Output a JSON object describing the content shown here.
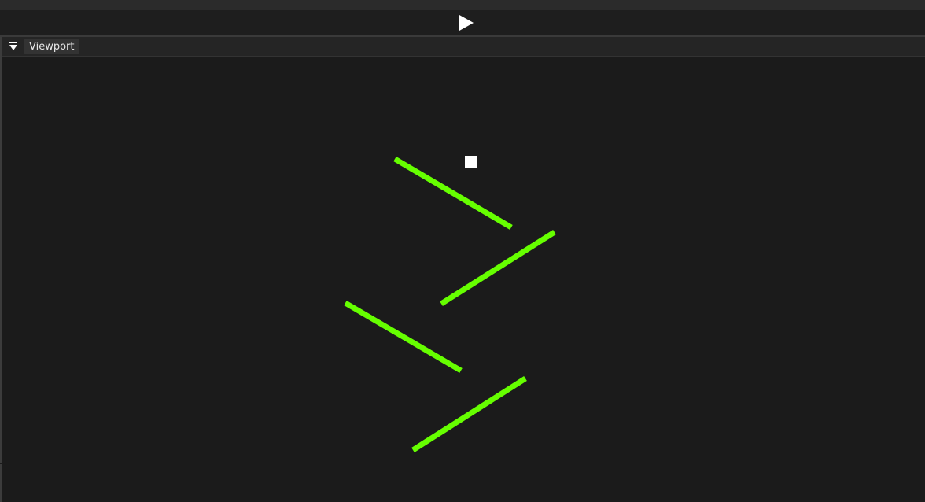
{
  "toolbar": {
    "play_icon": "play-icon"
  },
  "panel": {
    "collapse_icon": "collapse-toggle-icon",
    "tab_label": "Viewport"
  },
  "scene": {
    "platform_color": "#66ff00",
    "player_color": "#ffffff",
    "platform_count": 4,
    "player_icon": "square-player-icon"
  }
}
